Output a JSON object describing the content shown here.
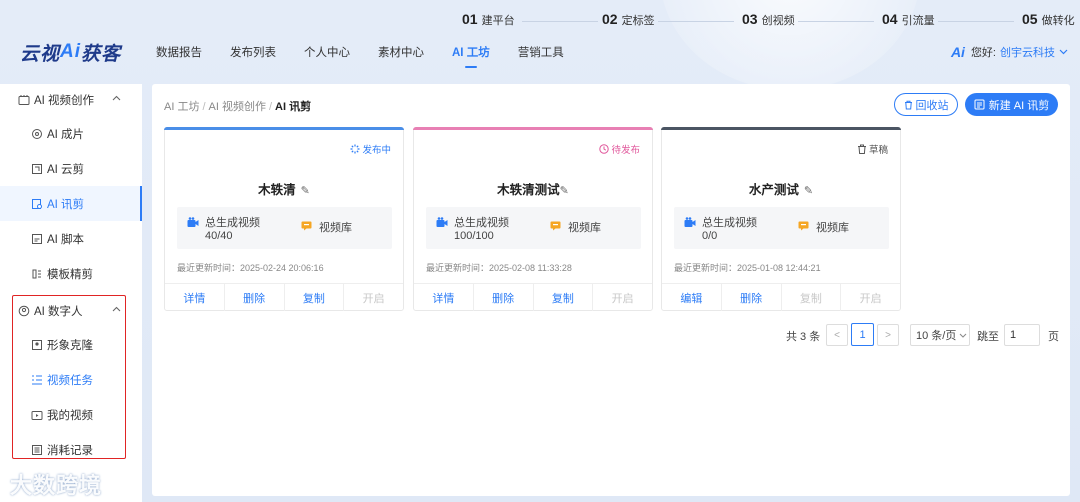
{
  "steps": [
    {
      "num": "01",
      "label": "建平台"
    },
    {
      "num": "02",
      "label": "定标签"
    },
    {
      "num": "03",
      "label": "创视频"
    },
    {
      "num": "04",
      "label": "引流量"
    },
    {
      "num": "05",
      "label": "做转化"
    }
  ],
  "brand": {
    "pre": "云视",
    "ai": "Ai",
    "post": "获客"
  },
  "nav": [
    "数据报告",
    "发布列表",
    "个人中心",
    "素材中心",
    "AI 工坊",
    "营销工具"
  ],
  "user": {
    "logo": "Ai",
    "greeting": "您好:",
    "name": "创宇云科技"
  },
  "sidebar": {
    "group1": "AI 视频创作",
    "group1_items": [
      "AI 成片",
      "AI 云剪",
      "AI 讯剪",
      "AI 脚本",
      "模板精剪"
    ],
    "group2": "AI 数字人",
    "group2_items": [
      "形象克隆",
      "视频任务",
      "我的视频",
      "消耗记录"
    ]
  },
  "watermark": "大数跨境",
  "breadcrumb": {
    "a": "AI 工坊",
    "b": "AI 视频创作",
    "c": "AI 讯剪"
  },
  "buttons": {
    "recycle": "回收站",
    "new": "新建 AI 讯剪"
  },
  "cards": [
    {
      "status": "发布中",
      "title": "木轶清",
      "stat_label": "总生成视频",
      "stat_value": "40/40",
      "library": "视频库",
      "updated": "最近更新时间：2025-02-24 20:06:16",
      "actions": [
        "详情",
        "删除",
        "复制",
        "开启"
      ],
      "color": "#4a8ee8",
      "status_color": "#2d7cf6"
    },
    {
      "status": "待发布",
      "title": "木轶清测试",
      "stat_label": "总生成视频",
      "stat_value": "100/100",
      "library": "视频库",
      "updated": "最近更新时间：2025-02-08 11:33:28",
      "actions": [
        "详情",
        "删除",
        "复制",
        "开启"
      ],
      "color": "#e880b4",
      "status_color": "#e0559a"
    },
    {
      "status": "草稿",
      "title": "水产测试",
      "stat_label": "总生成视频",
      "stat_value": "0/0",
      "library": "视频库",
      "updated": "最近更新时间：2025-01-08 12:44:21",
      "actions": [
        "编辑",
        "删除",
        "复制",
        "开启"
      ],
      "color": "#4b5563",
      "status_color": "#555555"
    }
  ],
  "pager": {
    "total": "共 3 条",
    "prev": "<",
    "page": "1",
    "next": ">",
    "size": "10 条/页",
    "goto": "跳至",
    "input": "1",
    "unit": "页"
  }
}
